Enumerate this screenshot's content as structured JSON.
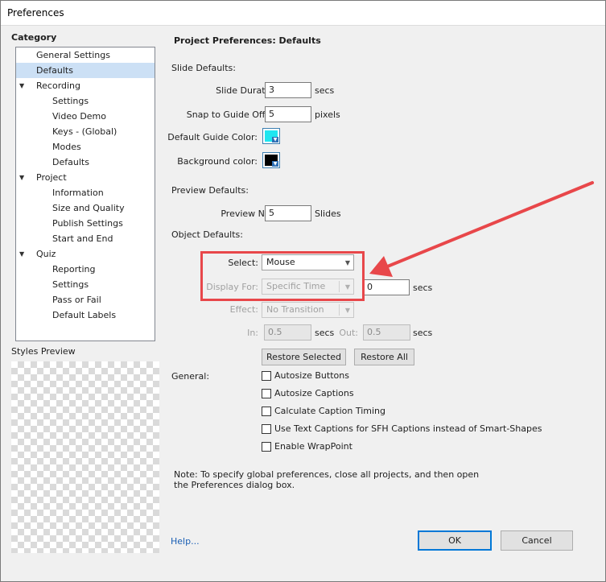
{
  "window": {
    "title": "Preferences"
  },
  "category": {
    "label": "Category",
    "items": [
      {
        "label": "General Settings",
        "level": 0,
        "expandable": false,
        "selected": false
      },
      {
        "label": "Defaults",
        "level": 0,
        "expandable": false,
        "selected": true
      },
      {
        "label": "Recording",
        "level": 0,
        "expandable": true,
        "selected": false
      },
      {
        "label": "Settings",
        "level": 1,
        "expandable": false,
        "selected": false
      },
      {
        "label": "Video Demo",
        "level": 1,
        "expandable": false,
        "selected": false
      },
      {
        "label": "Keys - (Global)",
        "level": 1,
        "expandable": false,
        "selected": false
      },
      {
        "label": "Modes",
        "level": 1,
        "expandable": false,
        "selected": false
      },
      {
        "label": "Defaults",
        "level": 1,
        "expandable": false,
        "selected": false
      },
      {
        "label": "Project",
        "level": 0,
        "expandable": true,
        "selected": false
      },
      {
        "label": "Information",
        "level": 1,
        "expandable": false,
        "selected": false
      },
      {
        "label": "Size and Quality",
        "level": 1,
        "expandable": false,
        "selected": false
      },
      {
        "label": "Publish Settings",
        "level": 1,
        "expandable": false,
        "selected": false
      },
      {
        "label": "Start and End",
        "level": 1,
        "expandable": false,
        "selected": false
      },
      {
        "label": "Quiz",
        "level": 0,
        "expandable": true,
        "selected": false
      },
      {
        "label": "Reporting",
        "level": 1,
        "expandable": false,
        "selected": false
      },
      {
        "label": "Settings",
        "level": 1,
        "expandable": false,
        "selected": false
      },
      {
        "label": "Pass or Fail",
        "level": 1,
        "expandable": false,
        "selected": false
      },
      {
        "label": "Default Labels",
        "level": 1,
        "expandable": false,
        "selected": false
      }
    ]
  },
  "styles_preview": {
    "label": "Styles Preview"
  },
  "panel": {
    "title": "Project Preferences: Defaults",
    "slide_defaults": {
      "heading": "Slide Defaults:",
      "slide_duration_label": "Slide Duration:",
      "slide_duration_value": "3",
      "slide_duration_unit": "secs",
      "snap_label": "Snap to Guide Offset:",
      "snap_value": "5",
      "snap_unit": "pixels",
      "guide_color_label": "Default Guide Color:",
      "guide_color": "#1fe6f0",
      "bg_color_label": "Background color:",
      "bg_color": "#000000"
    },
    "preview_defaults": {
      "heading": "Preview Defaults:",
      "preview_next_label": "Preview Next:",
      "preview_next_value": "5",
      "preview_next_unit": "Slides"
    },
    "object_defaults": {
      "heading": "Object Defaults:",
      "select_label": "Select:",
      "select_value": "Mouse",
      "display_for_label": "Display For:",
      "display_for_value": "Specific Time",
      "display_time_value": "0",
      "display_time_unit": "secs",
      "effect_label": "Effect:",
      "effect_value": "No Transition",
      "in_label": "In:",
      "in_value": "0.5",
      "in_unit": "secs",
      "out_label": "Out:",
      "out_value": "0.5",
      "out_unit": "secs",
      "restore_selected": "Restore Selected",
      "restore_all": "Restore All"
    },
    "general": {
      "heading": "General:",
      "options": [
        {
          "label": "Autosize Buttons",
          "checked": false
        },
        {
          "label": "Autosize Captions",
          "checked": false
        },
        {
          "label": "Calculate Caption Timing",
          "checked": false
        },
        {
          "label": "Use Text Captions for SFH Captions instead of Smart-Shapes",
          "checked": false
        },
        {
          "label": "Enable WrapPoint",
          "checked": false
        }
      ]
    },
    "note_line1": "Note: To specify global preferences, close all projects, and then open",
    "note_line2": "the Preferences dialog box."
  },
  "footer": {
    "help": "Help...",
    "ok": "OK",
    "cancel": "Cancel"
  },
  "annotation_color": "#e8474a"
}
